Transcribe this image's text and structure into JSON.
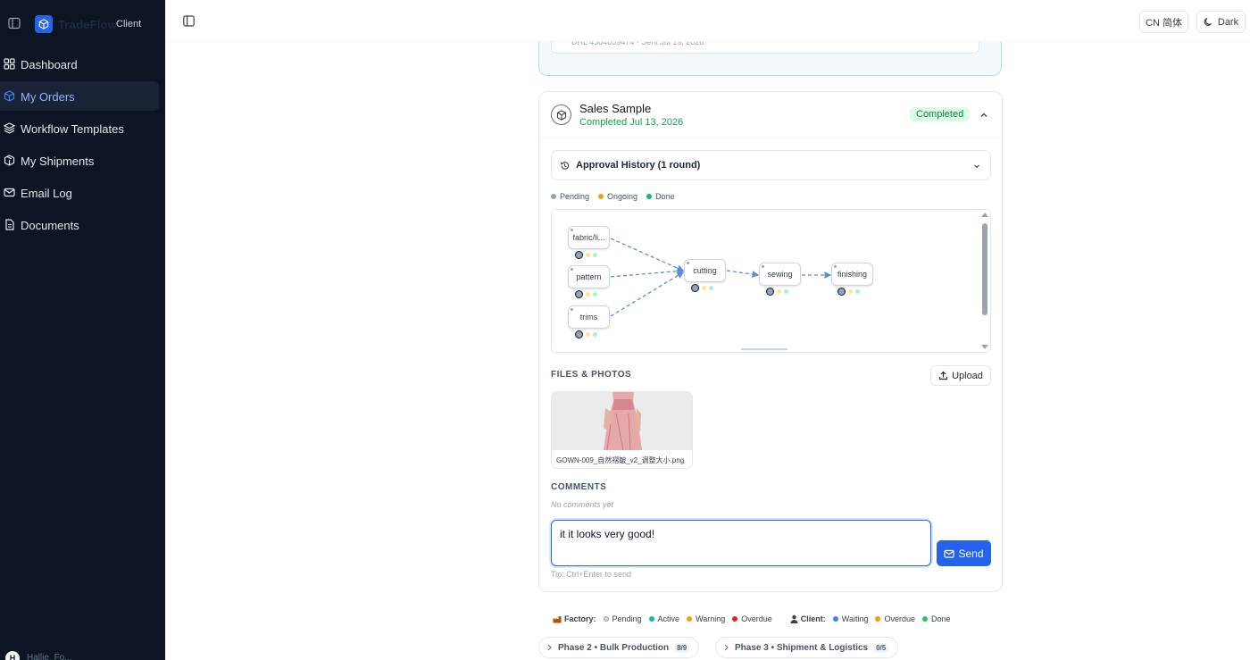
{
  "app": {
    "brand": "TradeFlow",
    "role": "Client"
  },
  "sidebar": {
    "items": [
      {
        "label": "Dashboard",
        "icon": "dashboard-icon"
      },
      {
        "label": "My Orders",
        "icon": "orders-icon",
        "active": true
      },
      {
        "label": "Workflow Templates",
        "icon": "layers-icon"
      },
      {
        "label": "My Shipments",
        "icon": "truck-icon"
      },
      {
        "label": "Email Log",
        "icon": "mail-icon"
      },
      {
        "label": "Documents",
        "icon": "document-icon"
      }
    ],
    "user": {
      "initial": "H",
      "name": "Hallie_Fo..."
    }
  },
  "topbar": {
    "lang": "CN 简体",
    "theme": "Dark"
  },
  "prev_card": {
    "text": "DHL 4584059474 · Sent Jul 19, 2026"
  },
  "stage": {
    "title": "Sales Sample",
    "subtitle": "Completed Jul 13, 2026",
    "status": "Completed",
    "approval_history": "Approval History (1 round)",
    "legend": [
      {
        "label": "Pending",
        "color": "#94a3b8"
      },
      {
        "label": "Ongoing",
        "color": "#f59e0b"
      },
      {
        "label": "Done",
        "color": "#10b981"
      }
    ],
    "flow_nodes": [
      "fabric/li...",
      "pattern",
      "trims",
      "cutting",
      "sewing",
      "finishing"
    ],
    "files_label": "FILES & PHOTOS",
    "upload": "Upload",
    "file_name": "GOWN-009_自然褶皺_v2_调整大小.png",
    "comments_label": "COMMENTS",
    "no_comments": "No comments yet",
    "comment_value": "it it looks very good!",
    "send": "Send",
    "tip": "Tip: Ctrl+Enter to send"
  },
  "status_legend": {
    "factory_label": "Factory:",
    "factory": [
      {
        "label": "Pending",
        "color": "#cbd5e1"
      },
      {
        "label": "Active",
        "color": "#14b8a6"
      },
      {
        "label": "Warning",
        "color": "#f59e0b"
      },
      {
        "label": "Overdue",
        "color": "#dc2626"
      }
    ],
    "client_label": "Client:",
    "client": [
      {
        "label": "Waiting",
        "color": "#3b82f6"
      },
      {
        "label": "Overdue",
        "color": "#f59e0b"
      },
      {
        "label": "Done",
        "color": "#22c55e"
      }
    ]
  },
  "phases": [
    {
      "label": "Phase 2 • Bulk Production",
      "count": "8/9"
    },
    {
      "label": "Phase 3 • Shipment & Logistics",
      "count": "0/5"
    }
  ]
}
